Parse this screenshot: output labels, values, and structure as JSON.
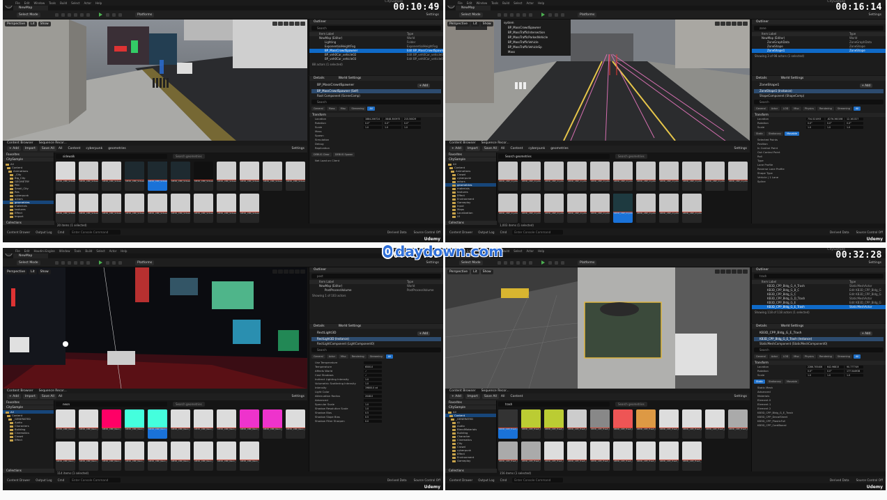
{
  "watermark": {
    "site": "daydown.com",
    "logo": "0"
  },
  "menu": [
    "File",
    "Edit",
    "Window",
    "Tools",
    "Build",
    "Select",
    "Actor",
    "Help"
  ],
  "menu_q3": [
    "File",
    "Edit",
    "Houdini Engine",
    "Window",
    "Tools",
    "Build",
    "Select",
    "Actor",
    "Help"
  ],
  "common": {
    "map_tab": "NewMap",
    "window_title": "CitySample",
    "select_mode": "Select Mode",
    "platforms": "Platforms",
    "settings": "Settings",
    "perspective": "Perspective",
    "lit": "Lit",
    "show": "Show",
    "outliner": "Outliner",
    "item_label": "Item Label",
    "type": "Type",
    "details": "Details",
    "world_settings": "World Settings",
    "add": "+ Add",
    "edit_cpp": "Edit in C++",
    "content_browser": "Content Browser",
    "sequence_recorder": "Sequence Recor...",
    "import": "Import",
    "save_all": "Save All",
    "favorites": "Favorites",
    "collections": "Collections",
    "content_drawer": "Content Drawer",
    "output_log": "Output Log",
    "cmd": "Cmd",
    "console_hint": "Enter Console Command",
    "derived_data": "Derived Data",
    "source_control": "Source Control Off",
    "udemy": "Udemy",
    "search": "Search",
    "filter_hint": "Search geometries"
  },
  "q1": {
    "timecode": "00:10:49",
    "outliner_rows": [
      {
        "label": "NewMap (Editor)",
        "type": "World"
      },
      {
        "label": "Lighting",
        "type": "Folder"
      },
      {
        "label": "ExponentialHeightFog",
        "type": "ExponentialHeightFog"
      },
      {
        "label": "BP_MassCrowdSpawner",
        "type": "Edit BP_MassCrowdSpawner"
      },
      {
        "label": "BP_veh0Car_vehicle02",
        "type": "Edit BP_veh0Car_vehicle02"
      },
      {
        "label": "BP_veh0Car_vehicle03",
        "type": "Edit BP_veh0Car_vehicle03"
      }
    ],
    "outliner_footer": "88 actors (1 selected)",
    "actor": "BP_MassCrowdSpawner",
    "components": [
      "BP_MassCrowdSpawner (Self)",
      "Root Component (SceneComp)"
    ],
    "cat_tabs": [
      "General",
      "Mass",
      "Misc",
      "Streaming",
      "All"
    ],
    "transform": "Transform",
    "props": [
      {
        "label": "Location",
        "values": [
          "1884.206724",
          "-5848.300975",
          "215.50029"
        ]
      },
      {
        "label": "Rotation",
        "values": [
          "0.0°",
          "0.0°",
          "0.0°"
        ]
      },
      {
        "label": "Scale",
        "values": [
          "1.0",
          "1.0",
          "1.0"
        ]
      }
    ],
    "sections": [
      "Mass",
      "Spawn",
      "Simulation",
      "Debug",
      "Replication"
    ],
    "debug_btns": [
      "DEBUG Clear",
      "DEBUG Spawn"
    ],
    "net_load": "Net Load on Client",
    "path": [
      "All",
      "Content",
      "cyberpunk",
      "geometries"
    ],
    "search": "sidewalk",
    "folders": [
      "All",
      "Content",
      "Animations",
      "_City",
      "Big_City",
      "GEOMETRY",
      "PBC",
      "Small_City",
      "Res",
      "cyberpunk",
      "actors",
      "geometries",
      "materials",
      "textures",
      "Effect",
      "Import"
    ],
    "tiles": [
      "KB3D_CBP_Sidewalk_A",
      "KB3D_CBP_Sidewalk_B",
      "KB3D_CBP_Sidewalk_C",
      "KB3D_CBP_Sidewalk_D",
      "KB3D_CBP_Sidewalk_E",
      "KB3D_CBP_Sidewalk_F",
      "KB3D_CBP_Sidewalk_G",
      "KB3D_CBP_Sidewalk_H",
      "KB3D_CBP_Sidewalk_I",
      "KB3D_CBP_Sidewalk_J",
      "KB3D_CBP_Sidewalk_K",
      "KB3D_CBP_Sidewalk_L",
      "KB3D_CBP_Sidewalk_M",
      "KB3D_CBP_Sidewalk_N",
      "KB3D_CBP_Sidewalk_O",
      "KB3D_CBP_Sidewalk_P",
      "KB3D_CBP_Sidewalk_Q",
      "KB3D_CBP_Sidewalk_R",
      "KB3D_CBP_Sidewalk_S",
      "KB3D_CBP_Sidewalk_T"
    ],
    "count": "20 items (1 selected)"
  },
  "q2": {
    "timecode": "00:16:14",
    "search": "zone",
    "outliner_rows": [
      {
        "label": "NewMap (Editor)",
        "type": "World"
      },
      {
        "label": "ZoneGraphData",
        "type": "ZoneGraphData"
      },
      {
        "label": "ZoneShape",
        "type": "ZoneShape"
      },
      {
        "label": "ZoneShape1",
        "type": "ZoneShape"
      }
    ],
    "outliner_footer": "Showing 3 of 98 actors (1 selected)",
    "overlay": [
      "system",
      "BP_MassCrowdSpawner",
      "BP_MassTrafficIntersection",
      "BP_MassTrafficParkedVehicle",
      "BP_MassTrafficVehicle",
      "BP_MassTrafficVehicleSp",
      "Mass"
    ],
    "actor": "ZoneShape1",
    "components": [
      "ZoneShape1 (Instance)",
      "ShapeComponent (ShapeComp)"
    ],
    "cat_tabs": [
      "General",
      "Actor",
      "LOD",
      "Misc",
      "Physics",
      "Rendering",
      "Streaming",
      "All"
    ],
    "transform": "Transform",
    "props": [
      {
        "label": "Location",
        "values": [
          "734.521093",
          "-6276.360198",
          "12.161327"
        ]
      },
      {
        "label": "Rotation",
        "values": [
          "0.0°",
          "0.0°",
          "0.0°"
        ]
      },
      {
        "label": "Scale",
        "values": [
          "1.0",
          "1.0",
          "1.0"
        ]
      }
    ],
    "mobility": [
      "Static",
      "Stationary",
      "Movable"
    ],
    "sections": [
      "Selected Points",
      "Position",
      "In Control Point",
      "Out Control Point",
      "Roll",
      "Type",
      "Lane Profile",
      "Reverse Lane Profile",
      "Shape Type"
    ],
    "lane_profile": "Vehicle | 1 Lane",
    "shape_type": "Spline",
    "path": [
      "All",
      "Content",
      "cyberpunk",
      "geometries"
    ],
    "folders": [
      "All",
      "Content",
      "Animations",
      "Crowd",
      "cyberpunk",
      "actors",
      "geometries",
      "materials",
      "textures",
      "Effect",
      "Environment",
      "Gameplay",
      "Input",
      "Maps",
      "Localization",
      "UI"
    ],
    "tiles": [
      "KB3D_CBP_Crystals_A",
      "KB3D_CBP_Crystals_B",
      "KB3D_CBP_Crystals_C",
      "KB3D_CBP_Crystals_D",
      "KB3D_CBP_Crystals_E",
      "KB3D_CBP_Crystals_F",
      "KB3D_CBP_Crystals_G",
      "KB3D_CBP_Crystals_H",
      "KB3D_CBP_Crystals_I",
      "KB3D_CBP_Crystals_J",
      "KB3D_CBP_Crystals_K",
      "KB3D_CBP_Crystals_L",
      "KB3D_CBP_Crystals_M",
      "KB3D_CBP_Crystals_N",
      "KB3D_CBP_Crystals_O",
      "KB3D_CBP_Crystals_P",
      "KB3D_CBP_Crystals_Q",
      "KB3D_CBP_Crystals_R",
      "KB3D_CBP_Crystals_S",
      "KB3D_CBP_Crystals_T"
    ],
    "count": "1,003 items (1 selected)"
  },
  "q3": {
    "timecode": "00:27:03",
    "search": "post",
    "outliner_rows": [
      {
        "label": "NewMap (Editor)",
        "type": "World"
      },
      {
        "label": "PostProcessVolume",
        "type": "PostProcessVolume"
      }
    ],
    "outliner_footer": "Showing 1 of 103 actors",
    "actor": "RectLight3D",
    "components": [
      "RectLight3D (Instance)",
      "RectLightComponent (LightComponent0)"
    ],
    "cat_tabs": [
      "General",
      "Actor",
      "Misc",
      "Rendering",
      "Streaming",
      "All"
    ],
    "props": [
      {
        "label": "Use Temperature",
        "values": [
          ""
        ]
      },
      {
        "label": "Temperature",
        "values": [
          "6500.0"
        ]
      },
      {
        "label": "Affects World",
        "values": [
          "✓"
        ]
      },
      {
        "label": "Cast Shadows",
        "values": [
          "✓"
        ]
      },
      {
        "label": "Indirect Lighting Intensity",
        "values": [
          "1.0"
        ]
      },
      {
        "label": "Volumetric Scattering Intensity",
        "values": [
          "1.0"
        ]
      },
      {
        "label": "Intensity",
        "values": [
          "19800.0 cd"
        ]
      },
      {
        "label": "Light Color",
        "values": [
          ""
        ]
      },
      {
        "label": "Attenuation Radius",
        "values": [
          "2048.0"
        ]
      },
      {
        "label": "Advanced",
        "values": [
          ""
        ]
      },
      {
        "label": "Specular Scale",
        "values": [
          "1.0"
        ]
      },
      {
        "label": "Shadow Resolution Scale",
        "values": [
          "1.0"
        ]
      },
      {
        "label": "Shadow Bias",
        "values": [
          "0.5"
        ]
      },
      {
        "label": "Shadow Slope Bias",
        "values": [
          "0.5"
        ]
      },
      {
        "label": "Shadow Filter Sharpen",
        "values": [
          "0.0"
        ]
      }
    ],
    "path": [
      "All"
    ],
    "cb_search": "neon",
    "folders": [
      "All",
      "Content",
      "_GENERATED",
      "Audio",
      "Characters",
      "Building",
      "Cinematics",
      "Crowd",
      "Effect"
    ],
    "tiles": [
      "KB3D_CBP_Neon_A",
      "KB3D_CBP_Neon_B",
      "KB3D_CBP_Neon_C",
      "KB3D_CBP_Neon_D",
      "KB3D_CBP_Neon_E",
      "KB3D_CBP_Neon_F",
      "KB3D_CBP_Neon_G",
      "KB3D_CBP_Neon_H",
      "KB3D_CBP_Neon_I",
      "KB3D_CBP_Neon_J",
      "KB3D_CBP_Neon_K",
      "KB3D_CBP_Neon_L",
      "KB3D_CBP_Neon_M",
      "KB3D_CBP_Neon_N",
      "KB3D_CBP_Neon_O",
      "KB3D_CBP_Neon_P",
      "KB3D_CBP_Neon_Q",
      "KB3D_CBP_Neon_R",
      "KB3D_CBP_Neon_S",
      "KB3D_CBP_Neon_T"
    ],
    "count": "114 items (1 selected)"
  },
  "q4": {
    "timecode": "00:32:28",
    "search": "trash",
    "outliner_rows": [
      {
        "label": "KB3D_CPP_Bldg_G_A_Trash",
        "type": "StaticMeshActor"
      },
      {
        "label": "KB3D_CPP_Bldg_G_B_C",
        "type": "Edit KB3D_CPP_Bldg_G"
      },
      {
        "label": "KB3D_CPP_Bldg_G_C",
        "type": "Edit KB3D_CPP_Bldg_G"
      },
      {
        "label": "KB3D_CPP_Bldg_G_D_Trash",
        "type": "StaticMeshActor"
      },
      {
        "label": "KB3D_CPP_Bldg_G_E",
        "type": "Edit KB3D_CPP_Bldg_G"
      },
      {
        "label": "KB3D_CPP_Bldg_G_E_Trash",
        "type": "StaticMeshActor"
      }
    ],
    "outliner_footer": "Showing 118 of 118 actors (1 selected)",
    "actor": "KB3D_CPP_Bldg_G_E_Trash",
    "components": [
      "KB3D_CPP_Bldg_G_E_Trash (Instance)",
      "StaticMeshComponent (StaticMeshComponent0)"
    ],
    "cat_tabs": [
      "General",
      "Actor",
      "LOD",
      "Misc",
      "Physics",
      "Rendering",
      "Streaming",
      "All"
    ],
    "transform": "Transform",
    "props": [
      {
        "label": "Location",
        "values": [
          "2286.705406",
          "642.96815",
          "90.777749"
        ]
      },
      {
        "label": "Rotation",
        "values": [
          "0.0°",
          "0.0°",
          "177.544938"
        ]
      },
      {
        "label": "Scale",
        "values": [
          "1.0",
          "1.0",
          "1.0"
        ]
      }
    ],
    "mobility": [
      "Static",
      "Stationary",
      "Movable"
    ],
    "static_mesh": "KB3D_CPP_Bldg_G_E_Trash",
    "sections": [
      "Static Mesh",
      "Advanced",
      "Materials",
      "Element 0",
      "Element 1",
      "Element 2"
    ],
    "materials": [
      "KB3D_CPP_DecalSheet",
      "KB3D_CPP_PlasticFull",
      "KB3D_CPP_CardBoard"
    ],
    "path": [
      "All",
      "Content"
    ],
    "folders": [
      "All",
      "Content",
      "_GENERATED",
      "AI",
      "Audio",
      "BlendMaterials",
      "Building",
      "Character",
      "Cinematics",
      "City",
      "Crowd",
      "cyberpunk",
      "Effect",
      "Environment",
      "Gameplay"
    ],
    "tiles": [
      "KB3D_CPP_Trash_A",
      "KB3D_CPP_Trash_B",
      "KB3D_CPP_Trash_C",
      "KB3D_CPP_Trash_D",
      "KB3D_CPP_Trash_E",
      "KB3D_CPP_Trash_F",
      "KB3D_CPP_Trash_G",
      "KB3D_CPP_Trash_H",
      "KB3D_CPP_Trash_I",
      "KB3D_CPP_Trash_J",
      "KB3D_CPP_Trash_K",
      "KB3D_CPP_Trash_L",
      "KB3D_CPP_Trash_M",
      "KB3D_CPP_Trash_N",
      "KB3D_CPP_Trash_O",
      "KB3D_CPP_Trash_P",
      "KB3D_CPP_Trash_Q",
      "KB3D_CPP_Trash_R",
      "KB3D_CPP_Trash_S",
      "KB3D_CPP_Trash_T"
    ],
    "count": "156 items (1 selected)"
  }
}
